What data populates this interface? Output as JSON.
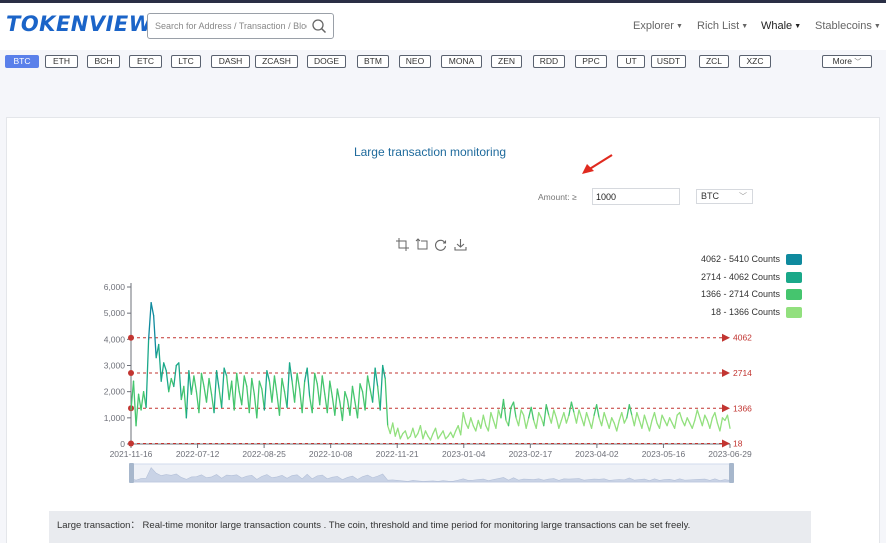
{
  "header": {
    "logo": "TOKENVIEW",
    "search_placeholder": "Search for Address / Transaction / Block",
    "nav": [
      {
        "label": "Explorer",
        "has_caret": true
      },
      {
        "label": "Rich List",
        "has_caret": true
      },
      {
        "label": "Whale",
        "has_caret": true
      },
      {
        "label": "Stablecoins",
        "has_caret": true
      }
    ]
  },
  "coins": [
    "BTC",
    "ETH",
    "BCH",
    "ETC",
    "LTC",
    "DASH",
    "ZCASH",
    "DOGE",
    "BTM",
    "NEO",
    "MONA",
    "ZEN",
    "RDD",
    "PPC",
    "UT",
    "USDT",
    "ZCL",
    "XZC"
  ],
  "active_coin": "BTC",
  "more_label": "More",
  "page": {
    "title": "Large transaction monitoring",
    "amount_label": "Amount: ≥",
    "amount_value": "1000",
    "selected_coin": "BTC",
    "note": "Large transaction： Real-time monitor large transaction counts . The coin, threshold and time period for monitoring large transactions can be set freely."
  },
  "colors": {
    "accent": "#5a80ea",
    "title": "#1e6a9c",
    "threshold_line": "#c23531",
    "band_1": "#0f8a9e",
    "band_2": "#1aa889",
    "band_3": "#45c56e",
    "band_4": "#92e07e"
  },
  "toolbox": [
    "zoom-select-icon",
    "zoom-reset-icon",
    "restore-icon",
    "save-image-icon"
  ],
  "chart_data": {
    "type": "line",
    "x_ticks": [
      "2021-11-16",
      "2022-07-12",
      "2022-08-25",
      "2022-10-08",
      "2022-11-21",
      "2023-01-04",
      "2023-02-17",
      "2023-04-02",
      "2023-05-16",
      "2023-06-29"
    ],
    "y_ticks": [
      0,
      1000,
      2000,
      3000,
      4000,
      5000,
      6000
    ],
    "ylim": [
      0,
      6000
    ],
    "grid": false,
    "legend_position": "top-right",
    "legend": [
      {
        "label": "4062 - 5410 Counts",
        "color": "#0f8a9e"
      },
      {
        "label": "2714 - 4062 Counts",
        "color": "#1aa889"
      },
      {
        "label": "1366 - 2714 Counts",
        "color": "#45c56e"
      },
      {
        "label": "18 - 1366 Counts",
        "color": "#92e07e"
      }
    ],
    "thresholds": [
      4062,
      2714,
      1366,
      18
    ],
    "series": [
      {
        "values": [
          1300,
          2400,
          700,
          1900,
          1300,
          2000,
          1400,
          4000,
          5400,
          4900,
          3300,
          3800,
          2400,
          3100,
          2800,
          2000,
          2500,
          2200,
          3000,
          3100,
          1700,
          2200,
          1000,
          2800,
          1900,
          2600,
          2000,
          1200,
          2700,
          2200,
          1600,
          2500,
          1900,
          1200,
          2800,
          2100,
          1400,
          2900,
          2600,
          1700,
          2400,
          1300,
          2700,
          2000,
          1500,
          2600,
          2200,
          1200,
          2500,
          1900,
          1000,
          2400,
          2100,
          1300,
          2800,
          2400,
          1600,
          2600,
          1900,
          1100,
          2500,
          2000,
          1400,
          3100,
          2400,
          1600,
          2700,
          2100,
          1200,
          2400,
          2900,
          1800,
          1200,
          2700,
          2300,
          1500,
          2600,
          1900,
          1200,
          2400,
          1800,
          1100,
          2100,
          1600,
          900,
          2000,
          1700,
          1100,
          2200,
          1600,
          1000,
          2300,
          2000,
          1300,
          2600,
          2100,
          1600,
          2900,
          2200,
          1300,
          3000,
          2500,
          700,
          400,
          800,
          300,
          600,
          200,
          400,
          500,
          200,
          300,
          600,
          250,
          400,
          700,
          200,
          500,
          300,
          150,
          400,
          600,
          200,
          350,
          500,
          200,
          300,
          450,
          250,
          500,
          700,
          350,
          1200,
          800,
          600,
          1000,
          700,
          500,
          900,
          600,
          1100,
          700,
          500,
          1200,
          900,
          600,
          1300,
          1000,
          1700,
          900,
          700,
          1400,
          1600,
          1000,
          700,
          1300,
          1100,
          600,
          1000,
          1400,
          900,
          600,
          1200,
          1000,
          700,
          1500,
          1100,
          800,
          1300,
          1000,
          600,
          900,
          1200,
          800,
          1100,
          1600,
          1200,
          800,
          1300,
          1000,
          700,
          1200,
          900,
          600,
          1100,
          1500,
          1000,
          700,
          1200,
          900,
          600,
          1000,
          800,
          500,
          900,
          1200,
          800,
          1000,
          1500,
          1100,
          700,
          1200,
          900,
          600,
          1100,
          800,
          500,
          900,
          1200,
          800,
          600,
          1100,
          900,
          700,
          1000,
          800,
          600,
          1100,
          1200,
          900,
          700,
          1000,
          800,
          600,
          900,
          1300,
          1000,
          700,
          1100,
          900,
          600,
          1000,
          1200,
          800,
          500,
          1000,
          900,
          1100,
          600
        ]
      }
    ]
  }
}
